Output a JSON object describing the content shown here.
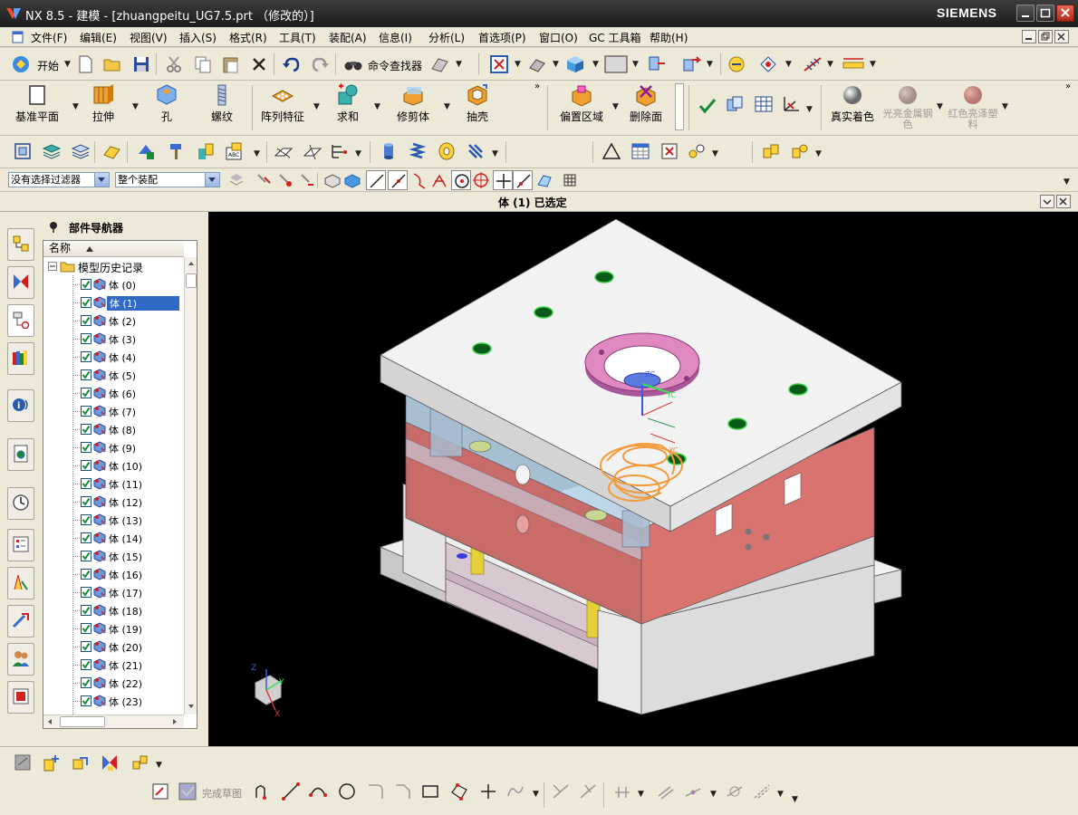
{
  "window": {
    "title": "NX 8.5 - 建模 - [zhuangpeitu_UG7.5.prt （修改的）]",
    "brand": "SIEMENS"
  },
  "menu": [
    "文件(F)",
    "编辑(E)",
    "视图(V)",
    "插入(S)",
    "格式(R)",
    "工具(T)",
    "装配(A)",
    "信息(I)",
    "分析(L)",
    "首选项(P)",
    "窗口(O)",
    "GC 工具箱",
    "帮助(H)"
  ],
  "toolbar1": {
    "start_label": "开始",
    "command_finder_label": "命令查找器"
  },
  "feature_toolbar": [
    {
      "label": "基准平面",
      "icon": "datum-plane-icon"
    },
    {
      "label": "拉伸",
      "icon": "extrude-icon"
    },
    {
      "label": "孔",
      "icon": "hole-icon"
    },
    {
      "label": "螺纹",
      "icon": "thread-icon"
    },
    {
      "label": "阵列特征",
      "icon": "pattern-feature-icon"
    },
    {
      "label": "求和",
      "icon": "unite-icon"
    },
    {
      "label": "修剪体",
      "icon": "trim-body-icon"
    },
    {
      "label": "抽壳",
      "icon": "shell-icon"
    },
    {
      "label": "偏置区域",
      "icon": "offset-region-icon"
    },
    {
      "label": "删除面",
      "icon": "delete-face-icon"
    },
    {
      "label": "真实着色",
      "icon": "true-shading-icon"
    },
    {
      "label": "光亮金属钢色",
      "icon": "shiny-metal-steel-icon"
    },
    {
      "label": "红色亮泽塑料",
      "icon": "red-glossy-plastic-icon"
    }
  ],
  "selection_bar": {
    "filter_value": "没有选择过滤器",
    "scope_value": "整个装配"
  },
  "status_message": "体 (1) 已选定",
  "navigator": {
    "title": "部件导航器",
    "column_header": "名称",
    "root_label": "模型历史记录",
    "selected_index": 1,
    "items": [
      "体 (0)",
      "体 (1)",
      "体 (2)",
      "体 (3)",
      "体 (4)",
      "体 (5)",
      "体 (6)",
      "体 (7)",
      "体 (8)",
      "体 (9)",
      "体 (10)",
      "体 (11)",
      "体 (12)",
      "体 (13)",
      "体 (14)",
      "体 (15)",
      "体 (16)",
      "体 (17)",
      "体 (18)",
      "体 (19)",
      "体 (20)",
      "体 (21)",
      "体 (22)",
      "体 (23)"
    ]
  },
  "viewport": {
    "triad_labels": {
      "x": "X",
      "y": "Y",
      "z": "Z"
    },
    "csys_labels": {
      "zc": "ZC",
      "yc": "YC",
      "xc": "XC"
    }
  },
  "sketch_toolbar": {
    "finish_sketch_label": "完成草图"
  },
  "colors": {
    "title_bg": "#2a2a2a",
    "toolbar_bg": "#ece9d8",
    "viewport_bg": "#000000",
    "plate_face": "#ececec",
    "cavity_plate": "#d8736f",
    "selection": "#316ac5",
    "highlight_orange": "#f29b3a",
    "locating_ring": "#e088c0"
  }
}
